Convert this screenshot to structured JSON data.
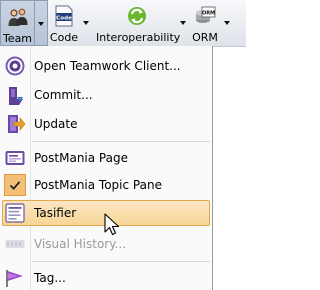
{
  "toolbar": {
    "team_label": "Team",
    "code_label": "Code",
    "interop_label": "Interoperability",
    "orm_label": "ORM",
    "code_icon_text": "Code",
    "orm_icon_text": "ORM"
  },
  "menu": {
    "items": [
      {
        "label": "Open Teamwork Client..."
      },
      {
        "label": "Commit..."
      },
      {
        "label": "Update"
      },
      {
        "label": "PostMania Page"
      },
      {
        "label": "PostMania Topic Pane"
      },
      {
        "label": "Tasifier"
      },
      {
        "label": "Visual History..."
      },
      {
        "label": "Tag..."
      }
    ]
  },
  "colors": {
    "highlight": "#f8d596",
    "highlight_border": "#e2a94c",
    "checked_bg": "#f3c07a",
    "pressed_bg": "#c9d3e2"
  },
  "icons": {
    "team": "team-icon",
    "code": "code-icon",
    "interop": "interoperability-icon",
    "orm": "orm-icon",
    "open": "teamwork-client-icon",
    "commit": "commit-icon",
    "update": "update-icon",
    "postmania_page": "postmania-page-icon",
    "postmania_topic": "checkmark-icon",
    "tasifier": "tasifier-icon",
    "visual_history": "visual-history-icon",
    "tag": "tag-icon"
  }
}
